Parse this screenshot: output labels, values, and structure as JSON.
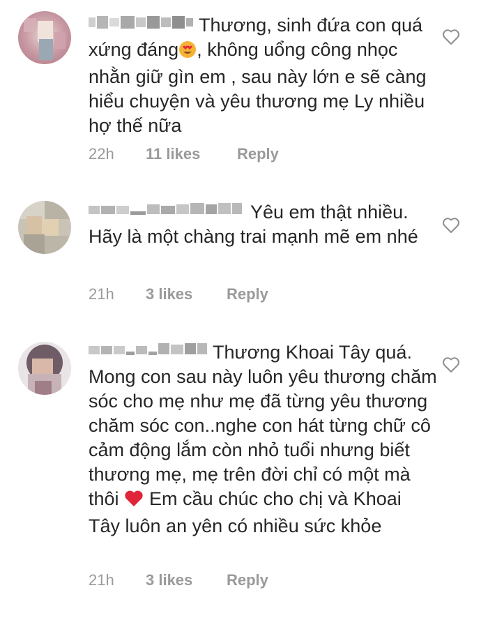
{
  "comments": [
    {
      "text_parts": [
        "Thương, sinh đứa con quá xứng đáng",
        ", không uổng công nhọc nhằn giữ gìn em , sau này lớn e sẽ càng hiểu chuyện và yêu thương mẹ Ly nhiều hợ thế nữa"
      ],
      "emoji": "heart-eyes-emoji",
      "time": "22h",
      "likes": "11 likes",
      "reply": "Reply"
    },
    {
      "text_parts": [
        "Yêu em thật nhiều. Hãy là một chàng trai mạnh mẽ em nhé"
      ],
      "time": "21h",
      "likes": "3 likes",
      "reply": "Reply"
    },
    {
      "text_parts": [
        "Thương Khoai Tây quá. Mong con sau này luôn yêu thương chăm sóc cho mẹ như mẹ đã từng yêu thương chăm sóc con..nghe con hát từng chữ cô cảm động lắm còn nhỏ tuổi nhưng biết thương mẹ, mẹ trên đời chỉ có một mà thôi",
        " Em cầu chúc cho chị và Khoai Tây luôn an yên có nhiều sức khỏe"
      ],
      "emoji": "red-heart-emoji",
      "time": "21h",
      "likes": "3 likes",
      "reply": "Reply"
    }
  ],
  "colors": {
    "text": "#262626",
    "meta": "#9a9a9a",
    "heart_outline": "#8e8e8e"
  },
  "icons": [
    "avatar",
    "blurred-username",
    "like-heart-icon",
    "heart-eyes-emoji",
    "red-heart-emoji"
  ]
}
